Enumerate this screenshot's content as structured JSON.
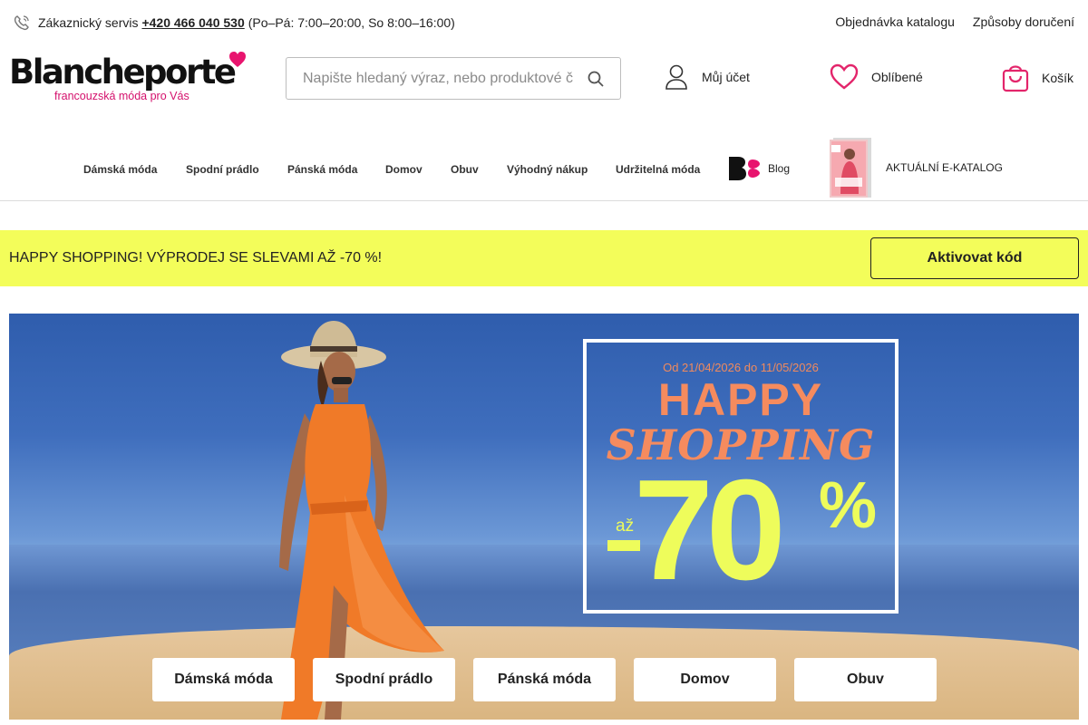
{
  "topbar": {
    "service_label": "Zákaznický servis",
    "phone": "+420 466 040 530",
    "hours": "(Po–Pá: 7:00–20:00, So 8:00–16:00)",
    "links": [
      "Objednávka katalogu",
      "Způsoby doručení"
    ]
  },
  "logo": {
    "wordmark": "Blancheporte",
    "tagline": "francouzská móda pro Vás"
  },
  "search": {
    "placeholder": "Napište hledaný výraz, nebo produktové č"
  },
  "header_actions": {
    "account": "Můj účet",
    "favorites": "Oblíbené",
    "cart": "Košík"
  },
  "nav": {
    "items": [
      "Dámská móda",
      "Spodní prádlo",
      "Pánská móda",
      "Domov",
      "Obuv",
      "Výhodný nákup",
      "Udržitelná móda"
    ],
    "blog": "Blog",
    "ecatalog": "AKTUÁLNÍ E-KATALOG"
  },
  "promo": {
    "text": "HAPPY SHOPPING! VÝPRODEJ SE SLEVAMI AŽ -70 %!",
    "button": "Aktivovat kód"
  },
  "hero": {
    "dates": "Od 21/04/2026 do 11/05/2026",
    "title_1": "HAPPY",
    "title_2": "SHOPPING",
    "upto": "až",
    "discount": "70",
    "percent": "%",
    "categories": [
      "Dámská móda",
      "Spodní prádlo",
      "Pánská móda",
      "Domov",
      "Obuv"
    ]
  },
  "colors": {
    "brand_pink": "#d4106c",
    "promo_yellow": "#f3fd5a",
    "sale_orange": "#f58b5e",
    "sale_yellow": "#eefc5b"
  },
  "icons": [
    "phone-icon",
    "heart-logo-icon",
    "search-icon",
    "user-icon",
    "heart-icon",
    "cart-icon"
  ]
}
